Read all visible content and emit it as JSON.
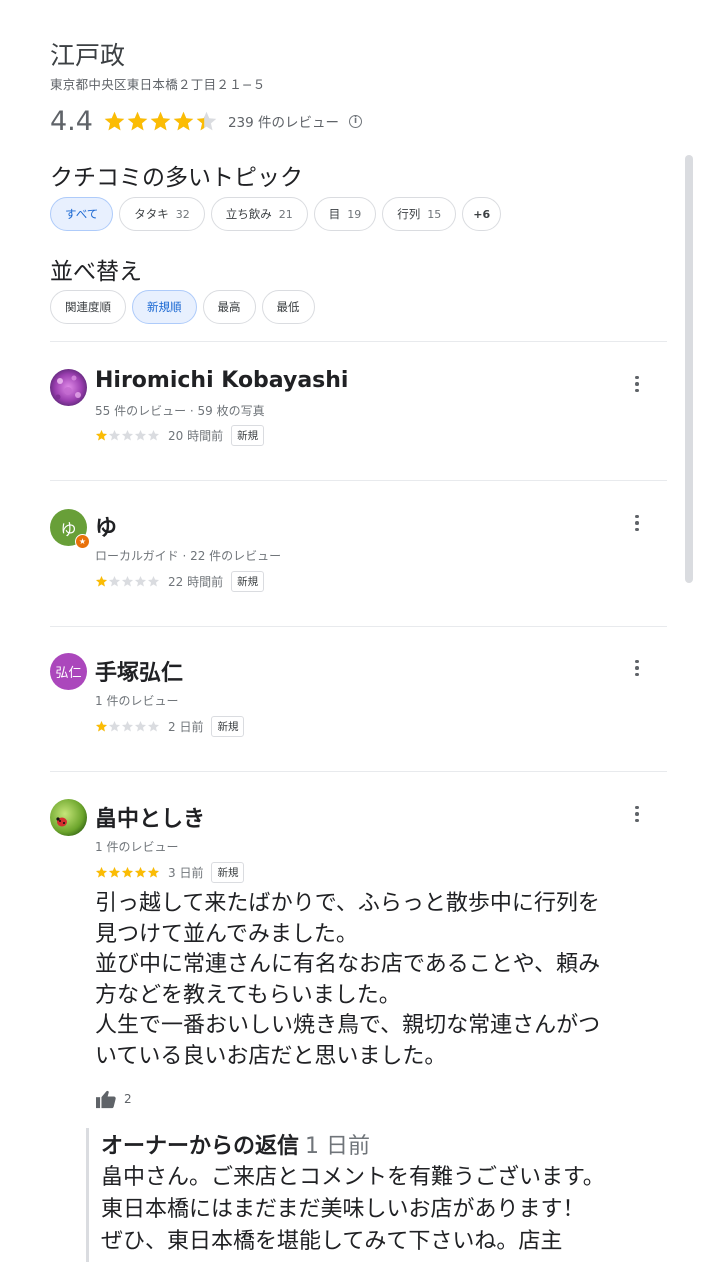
{
  "place": {
    "title": "江戸政",
    "address": "東京都中央区東日本橋２丁目２１−５",
    "rating": "4.4",
    "rating_stars": 4.4,
    "review_count": "239 件のレビュー",
    "info_icon": "info-icon"
  },
  "topics": {
    "title": "クチコミの多いトピック",
    "chips": [
      {
        "label": "すべて",
        "count": ""
      },
      {
        "label": "タタキ",
        "count": "32"
      },
      {
        "label": "立ち飲み",
        "count": "21"
      },
      {
        "label": "目",
        "count": "19"
      },
      {
        "label": "行列",
        "count": "15"
      },
      {
        "label": "+6",
        "count": ""
      }
    ],
    "selected_index": 0
  },
  "sort": {
    "title": "並べ替え",
    "options": [
      "関連度順",
      "新規順",
      "最高",
      "最低"
    ],
    "selected_index": 1
  },
  "reviews": [
    {
      "author": "Hiromichi Kobayashi",
      "meta": "55 件のレビュー · 59 枚の写真",
      "stars": 1,
      "time": "20 時間前",
      "badge": "新規",
      "avatar": "photo-purple"
    },
    {
      "author": "ゆ",
      "meta": "ローカルガイド · 22 件のレビュー",
      "stars": 1,
      "time": "22 時間前",
      "badge": "新規",
      "avatar_text": "ゆ",
      "avatar_color": "#689f38"
    },
    {
      "author": "手塚弘仁",
      "meta": "1 件のレビュー",
      "stars": 1,
      "time": "2 日前",
      "badge": "新規",
      "avatar_text": "弘仁",
      "avatar_color": "#ab47bc"
    },
    {
      "author": "畠中としき",
      "meta": "1 件のレビュー",
      "stars": 5,
      "time": "3 日前",
      "badge": "新規",
      "avatar": "photo-ladybug",
      "text_lines": [
        "引っ越して来たばかりで、ふらっと散歩中に行列を",
        "見つけて並んでみました。",
        "並び中に常連さんに有名なお店であることや、頼み",
        "方などを教えてもらいました。",
        "人生で一番おいしい焼き鳥で、親切な常連さんがつ",
        "いている良いお店だと思いました。"
      ],
      "likes": "2",
      "owner_reply": {
        "label": "オーナーからの返信",
        "time": "1 日前",
        "lines": [
          "畠中さん。ご来店とコメントを有難うございます。",
          "東日本橋にはまだまだ美味しいお店があります！",
          "ぜひ、東日本橋を堪能してみて下さいね。店主"
        ]
      }
    }
  ],
  "colors": {
    "star_filled": "#fbbc04",
    "star_empty": "#dadce0",
    "chip_selected_bg": "#e8f0fe",
    "chip_selected_text": "#1967d2"
  }
}
